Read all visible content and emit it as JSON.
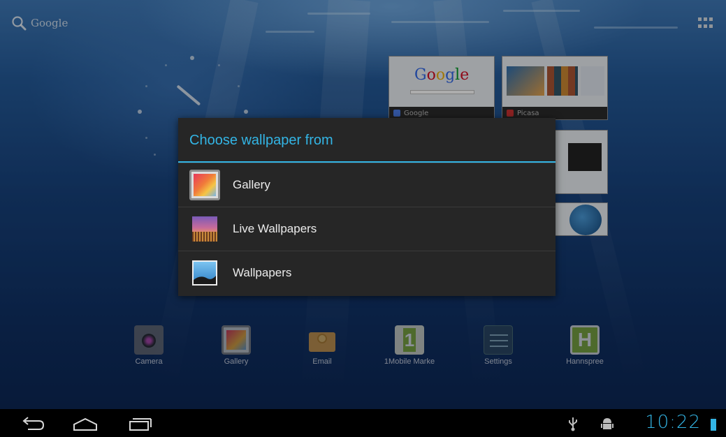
{
  "home": {
    "search_label": "Google",
    "search_icon": "search-icon",
    "apps_icon": "all-apps-grid-icon"
  },
  "browser_widget": {
    "tabs": [
      {
        "label": "Google",
        "logo": "Google"
      },
      {
        "label": "Picasa"
      }
    ]
  },
  "dock": {
    "items": [
      {
        "label": "Camera",
        "icon": "camera-icon"
      },
      {
        "label": "Gallery",
        "icon": "gallery-icon"
      },
      {
        "label": "Email",
        "icon": "email-icon"
      },
      {
        "label": "1Mobile Marke",
        "icon": "1mobile-market-icon"
      },
      {
        "label": "Settings",
        "icon": "settings-icon"
      },
      {
        "label": "Hannspree",
        "icon": "hannspree-icon"
      }
    ]
  },
  "dialog": {
    "title": "Choose wallpaper from",
    "options": [
      {
        "label": "Gallery",
        "icon": "gallery-icon"
      },
      {
        "label": "Live Wallpapers",
        "icon": "live-wallpapers-icon"
      },
      {
        "label": "Wallpapers",
        "icon": "wallpapers-icon"
      }
    ]
  },
  "system_bar": {
    "time": "10:22",
    "accent_color": "#33b5e5",
    "nav_icons": [
      "back-icon",
      "home-icon",
      "recent-apps-icon"
    ],
    "status_icons": [
      "usb-icon",
      "android-debug-icon",
      "battery-icon"
    ]
  }
}
